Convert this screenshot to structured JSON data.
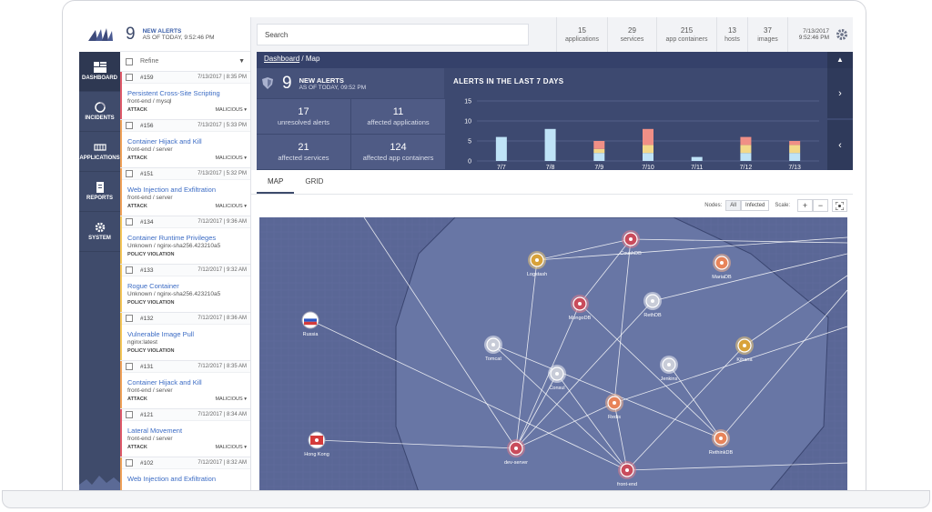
{
  "sidebar": {
    "items": [
      {
        "label": "DASHBOARD",
        "icon": "dashboard-icon",
        "active": true
      },
      {
        "label": "INCIDENTS",
        "icon": "incidents-icon",
        "active": false
      },
      {
        "label": "APPLICATIONS",
        "icon": "applications-icon",
        "active": false
      },
      {
        "label": "REPORTS",
        "icon": "reports-icon",
        "active": false
      },
      {
        "label": "SYSTEM",
        "icon": "gear-icon",
        "active": false
      }
    ]
  },
  "alerts_panel": {
    "count": "9",
    "title": "NEW ALERTS",
    "subtitle": "AS OF TODAY, 9:52:46 PM",
    "refine_label": "Refine",
    "items": [
      {
        "id": "#159",
        "time": "7/13/2017 | 8:35 PM",
        "name": "Persistent Cross-Site Scripting",
        "service": "front-end / mysql",
        "type": "ATTACK",
        "severity": "MALICIOUS",
        "color": "#e05b6a"
      },
      {
        "id": "#156",
        "time": "7/13/2017 | 5:33 PM",
        "name": "Container Hijack and Kill",
        "service": "front-end / server",
        "type": "ATTACK",
        "severity": "MALICIOUS",
        "color": "#f0a25a"
      },
      {
        "id": "#151",
        "time": "7/13/2017 | 5:32 PM",
        "name": "Web Injection and Exfiltration",
        "service": "front-end / server",
        "type": "ATTACK",
        "severity": "MALICIOUS",
        "color": "#f0a25a"
      },
      {
        "id": "#134",
        "time": "7/12/2017 | 9:36 AM",
        "name": "Container Runtime Privileges",
        "service": "Unknown / nginx-sha256.423210a5",
        "type": "POLICY VIOLATION",
        "severity": "",
        "color": "#f5c65a"
      },
      {
        "id": "#133",
        "time": "7/12/2017 | 9:32 AM",
        "name": "Rogue Container",
        "service": "Unknown / nginx-sha256.423210a5",
        "type": "POLICY VIOLATION",
        "severity": "",
        "color": "#f5c65a"
      },
      {
        "id": "#132",
        "time": "7/12/2017 | 8:36 AM",
        "name": "Vulnerable Image Pull",
        "service": "nginx:latest",
        "type": "POLICY VIOLATION",
        "severity": "",
        "color": "#f5c65a"
      },
      {
        "id": "#131",
        "time": "7/12/2017 | 8:35 AM",
        "name": "Container Hijack and Kill",
        "service": "front-end / server",
        "type": "ATTACK",
        "severity": "MALICIOUS",
        "color": "#f0a25a"
      },
      {
        "id": "#121",
        "time": "7/12/2017 | 8:34 AM",
        "name": "Lateral Movement",
        "service": "front-end / server",
        "type": "ATTACK",
        "severity": "MALICIOUS",
        "color": "#e05b6a"
      },
      {
        "id": "#102",
        "time": "7/12/2017 | 8:32 AM",
        "name": "Web Injection and Exfiltration",
        "service": "",
        "type": "",
        "severity": "",
        "color": "#f0a25a"
      }
    ]
  },
  "topbar": {
    "search_placeholder": "Search",
    "stats": [
      {
        "value": "15",
        "label": "applications"
      },
      {
        "value": "29",
        "label": "services"
      },
      {
        "value": "215",
        "label": "app containers"
      },
      {
        "value": "13",
        "label": "hosts"
      },
      {
        "value": "37",
        "label": "images"
      }
    ],
    "date": "7/13/2017",
    "time": "9:52:46 PM"
  },
  "breadcrumb": {
    "root": "Dashboard",
    "sep": "/",
    "current": "Map"
  },
  "summary": {
    "count": "9",
    "title": "NEW ALERTS",
    "subtitle": "AS OF TODAY, 09:52 PM",
    "metrics": [
      {
        "value": "17",
        "label": "unresolved alerts"
      },
      {
        "value": "11",
        "label": "affected applications"
      },
      {
        "value": "21",
        "label": "affected services"
      },
      {
        "value": "124",
        "label": "affected app containers"
      }
    ],
    "chart_title": "ALERTS IN THE LAST 7 DAYS"
  },
  "chart_data": {
    "type": "bar",
    "title": "ALERTS IN THE LAST 7 DAYS",
    "categories": [
      "7/7",
      "7/8",
      "7/9",
      "7/10",
      "7/11",
      "7/12",
      "7/13"
    ],
    "series": [
      {
        "values": [
          6,
          8,
          2,
          2,
          1,
          2,
          2
        ],
        "color": "#bfe3f7"
      },
      {
        "values": [
          0,
          0,
          1,
          2,
          0,
          2,
          2
        ],
        "color": "#f3d98a"
      },
      {
        "values": [
          0,
          0,
          2,
          4,
          0,
          2,
          1
        ],
        "color": "#f08f86"
      }
    ],
    "yticks": [
      0,
      5,
      10,
      15
    ],
    "ylim": [
      0,
      15
    ],
    "grid": true,
    "stacked": true
  },
  "map_panel": {
    "tabs": [
      {
        "label": "MAP",
        "active": true
      },
      {
        "label": "GRID",
        "active": false
      }
    ],
    "nodes_label": "Nodes:",
    "nodes_options": [
      "All",
      "Infected"
    ],
    "scale_label": "Scale:",
    "zoom_in": "+",
    "zoom_out": "−",
    "nodes": [
      {
        "label": "Russia",
        "kind": "flag-ru"
      },
      {
        "label": "Hong Kong",
        "kind": "flag-hk"
      },
      {
        "label": "Logstash",
        "kind": "yellow"
      },
      {
        "label": "CouchDB",
        "kind": "red"
      },
      {
        "label": "MariaDB",
        "kind": "orange"
      },
      {
        "label": "MongoDB",
        "kind": "red"
      },
      {
        "label": "RethDB",
        "kind": "white"
      },
      {
        "label": "Tomcat",
        "kind": "white"
      },
      {
        "label": "Consul",
        "kind": "white"
      },
      {
        "label": "Jenkins",
        "kind": "white"
      },
      {
        "label": "Kibana",
        "kind": "yellow"
      },
      {
        "label": "Redis",
        "kind": "orange"
      },
      {
        "label": "RethinkDB",
        "kind": "orange"
      },
      {
        "label": "dev-server",
        "kind": "red"
      },
      {
        "label": "front-end",
        "kind": "red"
      }
    ]
  }
}
